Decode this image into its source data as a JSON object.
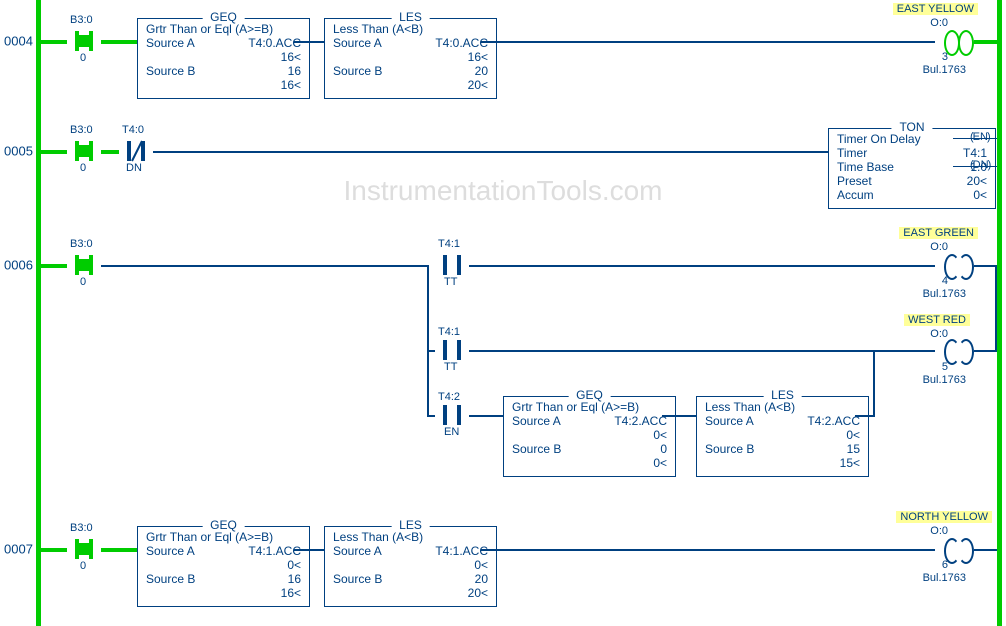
{
  "watermark": "InstrumentationTools.com",
  "rungs": {
    "r4": {
      "num": "0004",
      "contact_tag": "B3:0",
      "contact_bit": "0"
    },
    "r5": {
      "num": "0005",
      "contact_tag": "B3:0",
      "contact_bit": "0",
      "xio_tag": "T4:0",
      "xio_bit": "DN"
    },
    "r6": {
      "num": "0006",
      "contact_tag": "B3:0",
      "contact_bit": "0",
      "branch1_tag": "T4:1",
      "branch1_bit": "TT",
      "branch2_tag": "T4:1",
      "branch2_bit": "TT",
      "branch3_tag": "T4:2",
      "branch3_bit": "EN"
    },
    "r7": {
      "num": "0007",
      "contact_tag": "B3:0",
      "contact_bit": "0"
    }
  },
  "geq4": {
    "title": "GEQ",
    "desc": "Grtr Than or Eql (A>=B)",
    "sa_lbl": "Source A",
    "sa_val": "T4:0.ACC",
    "sa_live": "16<",
    "sb_lbl": "Source B",
    "sb_val": "16",
    "sb_live": "16<"
  },
  "les4": {
    "title": "LES",
    "desc": "Less Than (A<B)",
    "sa_lbl": "Source A",
    "sa_val": "T4:0.ACC",
    "sa_live": "16<",
    "sb_lbl": "Source B",
    "sb_val": "20",
    "sb_live": "20<"
  },
  "out4": {
    "hl": "EAST YELLOW",
    "tag": "O:0",
    "bit": "3",
    "dev": "Bul.1763"
  },
  "ton5": {
    "title": "TON",
    "desc": "Timer On Delay",
    "t_lbl": "Timer",
    "t_val": "T4:1",
    "tb_lbl": "Time Base",
    "tb_val": "1.0",
    "p_lbl": "Preset",
    "p_val": "20<",
    "a_lbl": "Accum",
    "a_val": "0<",
    "en": "EN",
    "dn": "DN"
  },
  "out6a": {
    "hl": "EAST GREEN",
    "tag": "O:0",
    "bit": "4",
    "dev": "Bul.1763"
  },
  "out6b": {
    "hl": "WEST RED",
    "tag": "O:0",
    "bit": "5",
    "dev": "Bul.1763"
  },
  "geq6": {
    "title": "GEQ",
    "desc": "Grtr Than or Eql (A>=B)",
    "sa_lbl": "Source A",
    "sa_val": "T4:2.ACC",
    "sa_live": "0<",
    "sb_lbl": "Source B",
    "sb_val": "0",
    "sb_live": "0<"
  },
  "les6": {
    "title": "LES",
    "desc": "Less Than (A<B)",
    "sa_lbl": "Source A",
    "sa_val": "T4:2.ACC",
    "sa_live": "0<",
    "sb_lbl": "Source B",
    "sb_val": "15",
    "sb_live": "15<"
  },
  "geq7": {
    "title": "GEQ",
    "desc": "Grtr Than or Eql (A>=B)",
    "sa_lbl": "Source A",
    "sa_val": "T4:1.ACC",
    "sa_live": "0<",
    "sb_lbl": "Source B",
    "sb_val": "16",
    "sb_live": "16<"
  },
  "les7": {
    "title": "LES",
    "desc": "Less Than (A<B)",
    "sa_lbl": "Source A",
    "sa_val": "T4:1.ACC",
    "sa_live": "0<",
    "sb_lbl": "Source B",
    "sb_val": "20",
    "sb_live": "20<"
  },
  "out7": {
    "hl": "NORTH YELLOW",
    "tag": "O:0",
    "bit": "6",
    "dev": "Bul.1763"
  }
}
